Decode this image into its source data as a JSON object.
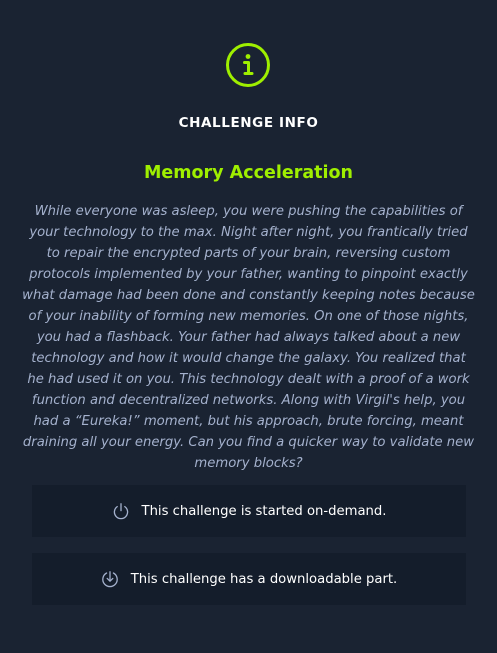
{
  "header": {
    "icon": "info-circle-icon",
    "title": "CHALLENGE INFO"
  },
  "challenge": {
    "name": "Memory Acceleration",
    "description": "While everyone was asleep, you were pushing the capabilities of your technology to the max. Night after night, you frantically tried to repair the encrypted parts of your brain, reversing custom protocols implemented by your father, wanting to pinpoint exactly what damage had been done and constantly keeping notes because of your inability of forming new memories. On one of those nights, you had a flashback. Your father had always talked about a new technology and how it would change the galaxy. You realized that he had used it on you. This technology dealt with a proof of a work function and decentralized networks. Along with Virgil's help, you had a “Eureka!” moment, but his approach, brute forcing, meant draining all your energy. Can you find a quicker way to validate new memory blocks?"
  },
  "info_rows": [
    {
      "icon": "power-icon",
      "text": "This challenge is started on-demand."
    },
    {
      "icon": "download-icon",
      "text": "This challenge has a downloadable part."
    }
  ],
  "colors": {
    "background": "#1a2332",
    "row_background": "#141d2b",
    "accent": "#9fef00",
    "description": "#a4b1cd",
    "heading": "#ffffff"
  }
}
